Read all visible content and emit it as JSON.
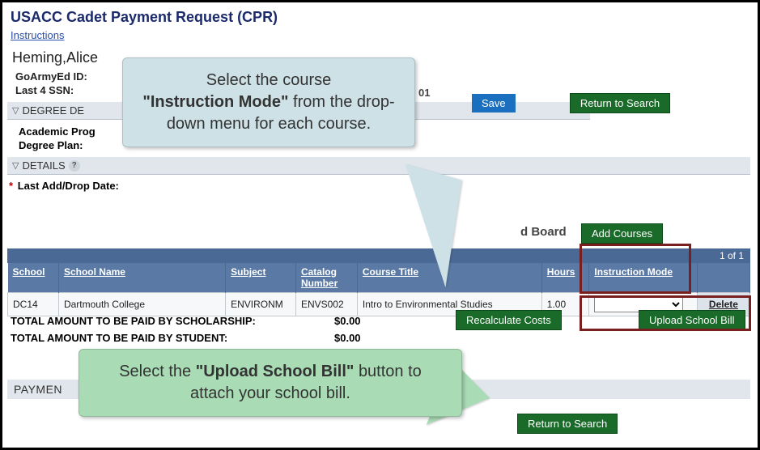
{
  "header": {
    "title": "USACC Cadet Payment Request (CPR)",
    "instructions_link": "Instructions"
  },
  "student": {
    "name": "Heming,Alice",
    "goarmyed_label": "GoArmyEd ID:",
    "last4_label": "Last 4 SSN:",
    "partial_right": "01"
  },
  "buttons": {
    "save": "Save",
    "return_to_search": "Return to Search",
    "add_courses": "Add Courses",
    "recalculate": "Recalculate Costs",
    "upload_school_bill": "Upload School Bill",
    "delete": "Delete"
  },
  "sections": {
    "degree": "DEGREE DE",
    "details": "DETAILS",
    "payment": "PAYMEN"
  },
  "degree_fields": {
    "academic_prog": "Academic Prog",
    "degree_plan": "Degree Plan:"
  },
  "details": {
    "last_add_label": "Last Add/Drop Date:",
    "radio_right": "d Board"
  },
  "grid": {
    "pager": "1 of 1",
    "headers": {
      "school": "School",
      "school_name": "School Name",
      "subject": "Subject",
      "catalog": "Catalog Number",
      "course_title": "Course Title",
      "hours": "Hours",
      "instruction_mode": "Instruction Mode"
    },
    "row": {
      "school": "DC14",
      "school_name": "Dartmouth College",
      "subject": "ENVIRONM",
      "catalog": "ENVS002",
      "course_title": "Intro to Environmental Studies",
      "hours": "1.00"
    }
  },
  "totals": {
    "scholarship_label": "TOTAL AMOUNT TO BE PAID BY SCHOLARSHIP:",
    "scholarship_value": "$0.00",
    "student_label": "TOTAL AMOUNT TO BE PAID BY STUDENT:",
    "student_value": "$0.00"
  },
  "callouts": {
    "blue_pre": "Select the course ",
    "blue_bold": "\"Instruction Mode\"",
    "blue_post": " from the drop-down menu for each course.",
    "green_pre": "Select the ",
    "green_bold": "\"Upload School Bill\"",
    "green_post": " button to attach your school bill."
  }
}
